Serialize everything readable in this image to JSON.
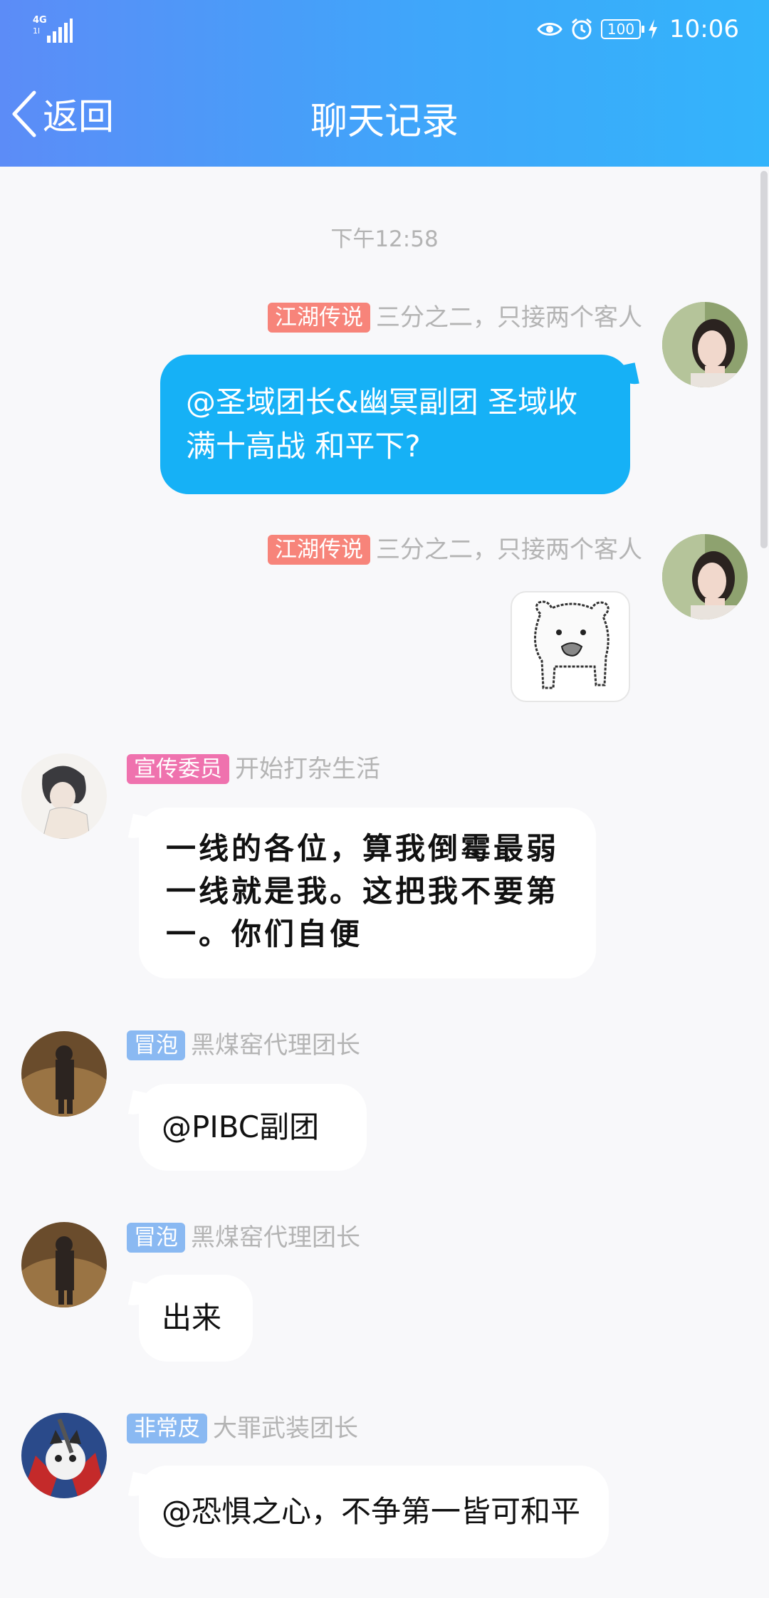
{
  "status_bar": {
    "network": "4G",
    "battery": "100",
    "time": "10:06"
  },
  "navbar": {
    "back_label": "返回",
    "title": "聊天记录"
  },
  "timestamp": "下午12:58",
  "messages": [
    {
      "side": "right",
      "badge": "江湖传说",
      "badge_color": "#f7847a",
      "sender": "三分之二，只接两个客人",
      "text": "@圣域团长&幽冥副团 圣域收满十高战 和平下?"
    },
    {
      "side": "right",
      "badge": "江湖传说",
      "badge_color": "#f7847a",
      "sender": "三分之二，只接两个客人",
      "sticker": "bear-sticker"
    },
    {
      "side": "left",
      "badge": "宣传委员",
      "badge_color": "#ef72ae",
      "sender": "开始打杂生活",
      "text": "一线的各位，算我倒霉最弱一线就是我。这把我不要第一。你们自便"
    },
    {
      "side": "left",
      "badge": "冒泡",
      "badge_color": "#8ab9f2",
      "sender": "黑煤窑代理团长",
      "text": "@PIBC副团"
    },
    {
      "side": "left",
      "badge": "冒泡",
      "badge_color": "#8ab9f2",
      "sender": "黑煤窑代理团长",
      "text": "出来"
    },
    {
      "side": "left",
      "badge": "非常皮",
      "badge_color": "#8ab9f2",
      "sender": "大罪武装团长",
      "text": "@恐惧之心，不争第一皆可和平"
    }
  ]
}
